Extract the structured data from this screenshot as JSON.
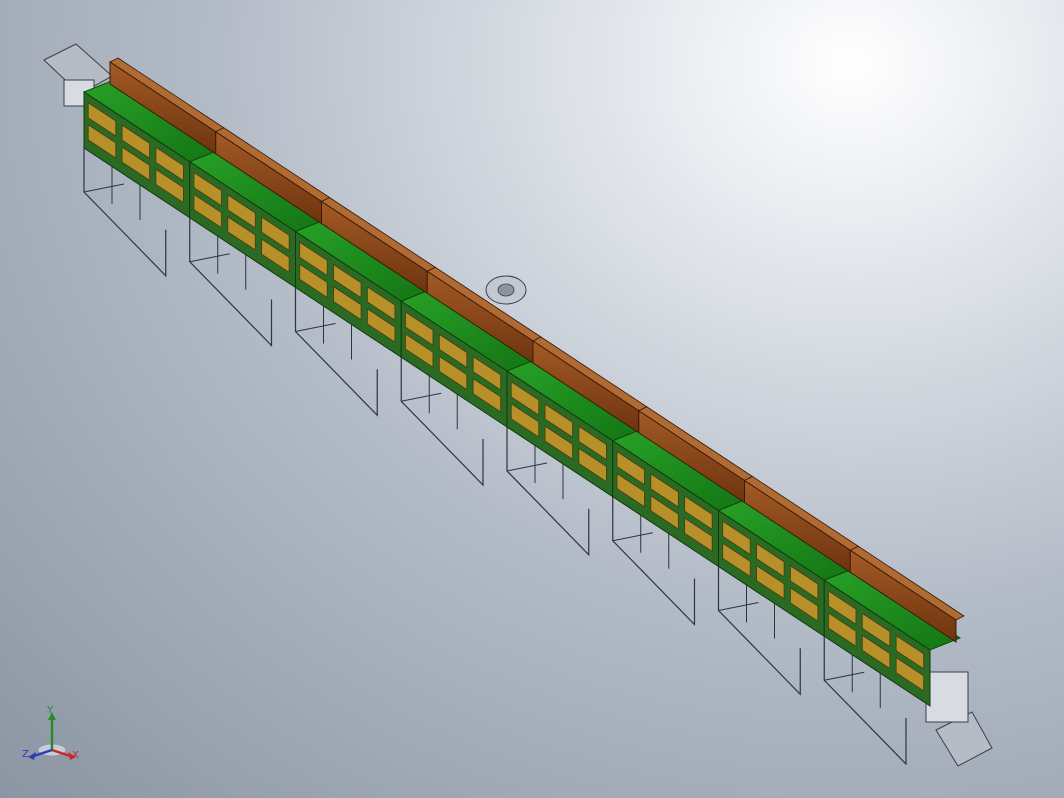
{
  "viewport": {
    "background_top": "#ffffff",
    "background_bottom": "#8c95a3",
    "model_colors": {
      "hood": "#8a4414",
      "hood_side": "#5e2c0c",
      "panel_top": "#1a8a1a",
      "panel_side": "#2a6a22",
      "heater_window": "#b8902a",
      "frame": "#2c3444",
      "end_cap": "#c8ccd4"
    },
    "module_count": 8
  },
  "triad": {
    "y_label": "Y",
    "x_label": "X",
    "z_label": "Z",
    "y_color": "#2a8a2a",
    "x_color": "#c62a2a",
    "z_color": "#2a3fb4"
  }
}
